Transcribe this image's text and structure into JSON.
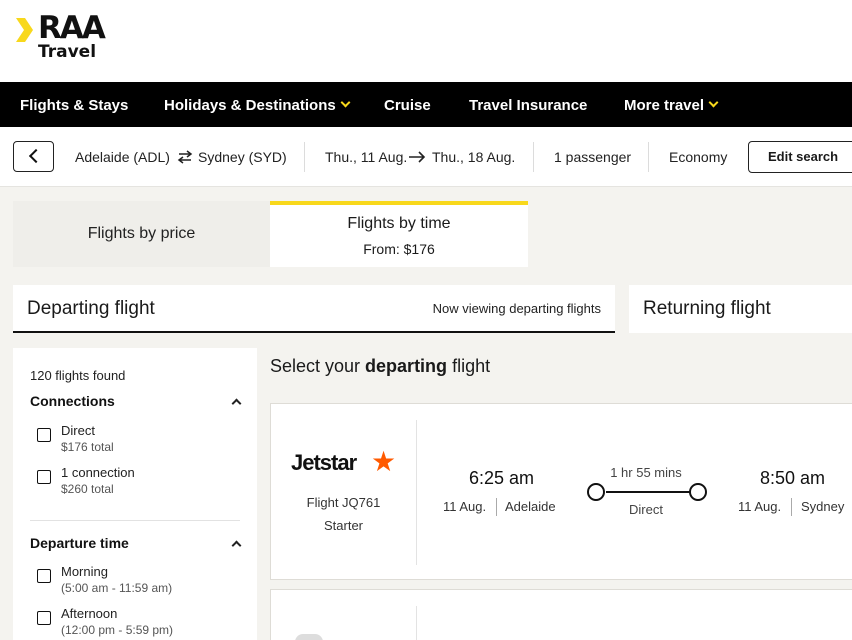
{
  "brand": {
    "name": "RAA",
    "sub": "Travel",
    "accent": "#f8d81c"
  },
  "nav": [
    {
      "label": "Flights & Stays",
      "dropdown": false
    },
    {
      "label": "Holidays & Destinations",
      "dropdown": true
    },
    {
      "label": "Cruise",
      "dropdown": false
    },
    {
      "label": "Travel Insurance",
      "dropdown": false
    },
    {
      "label": "More travel",
      "dropdown": true
    }
  ],
  "search": {
    "origin": "Adelaide (ADL)",
    "swap_icon": "swap-arrows-icon",
    "destination": "Sydney (SYD)",
    "depart_date": "Thu., 11 Aug.",
    "return_date": "Thu., 18 Aug.",
    "passengers": "1 passenger",
    "cabin": "Economy",
    "edit_label": "Edit search"
  },
  "tabs": [
    {
      "label": "Flights by price",
      "sub": ""
    },
    {
      "label": "Flights by time",
      "sub": "From: $176",
      "active": true
    }
  ],
  "departing": {
    "title": "Departing flight",
    "note": "Now viewing departing flights"
  },
  "returning": {
    "title": "Returning flight"
  },
  "filters": {
    "count": "120 flights found",
    "connections": {
      "title": "Connections",
      "options": [
        {
          "label": "Direct",
          "sub": "$176 total"
        },
        {
          "label": "1 connection",
          "sub": "$260 total"
        }
      ]
    },
    "departure_time": {
      "title": "Departure time",
      "options": [
        {
          "label": "Morning",
          "sub": "(5:00 am - 11:59 am)"
        },
        {
          "label": "Afternoon",
          "sub": "(12:00 pm - 5:59 pm)"
        }
      ]
    }
  },
  "results": {
    "title_pre": "Select your ",
    "title_bold": "departing",
    "title_post": " flight",
    "flights": [
      {
        "airline": "Jetstar",
        "flight": "Flight JQ761",
        "fare": "Starter",
        "depart_time": "6:25 am",
        "depart_date": "11 Aug.",
        "depart_city": "Adelaide",
        "duration": "1 hr 55 mins",
        "stops": "Direct",
        "arrive_time": "8:50 am",
        "arrive_date": "11 Aug.",
        "arrive_city": "Sydney"
      }
    ]
  }
}
